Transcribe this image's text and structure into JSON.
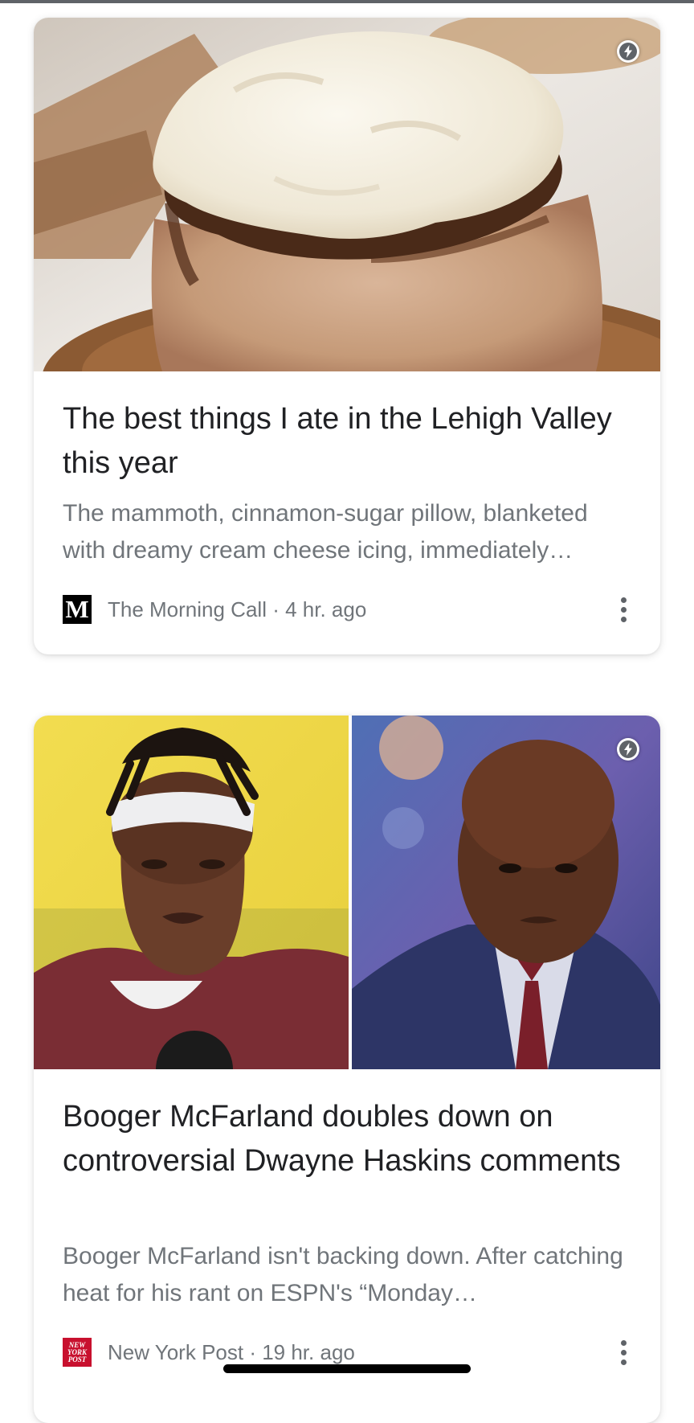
{
  "articles": [
    {
      "headline": "The best things I ate in the Lehigh Valley this year",
      "snippet": "The mammoth, cinnamon-sugar pillow, blanketed with dreamy cream cheese icing, immediately…",
      "source": "The Morning Call",
      "age": "4 hr. ago",
      "image": "cinnamon roll with cream cheese icing",
      "logo_text": "M"
    },
    {
      "headline": "Booger McFarland doubles down on controversial Dwayne Haskins comments",
      "snippet": "Booger McFarland isn't backing down. After catching heat for his rant on ESPN's “Monday…",
      "source": "New York Post",
      "age": "19 hr. ago",
      "image": "two portraits: football player in headband and man in suit",
      "logo_text": "NEW YORK POST"
    }
  ],
  "separator": " · ",
  "icons": {
    "amp": "lightning-bolt-icon",
    "menu": "more-vert-icon"
  },
  "colors": {
    "title": "#202124",
    "secondary": "#70757a",
    "post_red": "#c8102e"
  }
}
